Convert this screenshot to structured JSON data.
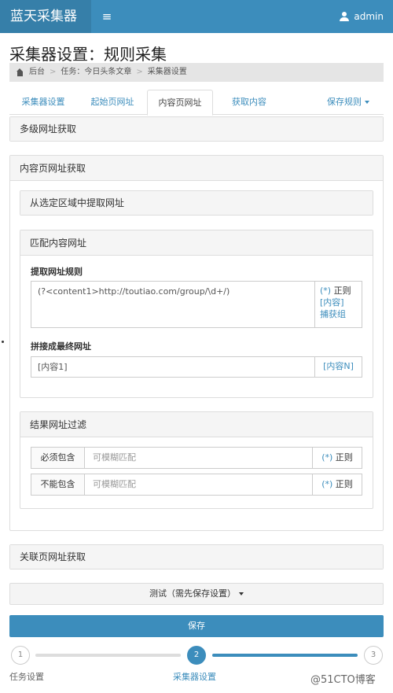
{
  "header": {
    "brand": "蓝天采集器",
    "menu_icon": "≡",
    "user": "admin"
  },
  "page": {
    "title": "采集器设置：规则采集"
  },
  "breadcrumb": {
    "home": "后台",
    "task": "任务：今日头条文章",
    "current": "采集器设置"
  },
  "tabs": [
    {
      "label": "采集器设置"
    },
    {
      "label": "起始页网址"
    },
    {
      "label": "内容页网址"
    },
    {
      "label": "获取内容"
    }
  ],
  "save_rules": {
    "label": "保存规则"
  },
  "sections": {
    "multi_level": "多级网址获取",
    "content_url": "内容页网址获取",
    "extract_region": "从选定区域中提取网址",
    "match_content": "匹配内容网址",
    "result_filter": "结果网址过滤",
    "related_url": "关联页网址获取"
  },
  "match": {
    "rule_label": "提取网址规则",
    "rule_value": "(?<content1>http://toutiao.com/group/\\d+/)",
    "rule_addon_regex": "(*)",
    "rule_addon_regex_label": "正则",
    "rule_addon_content": "[内容]",
    "rule_addon_capture": "捕获组",
    "final_label": "拼接成最终网址",
    "final_value": "[内容1]",
    "final_addon": "[内容N]"
  },
  "filters": [
    {
      "label": "必须包含",
      "placeholder": "可模糊匹配",
      "addon_symbol": "(*)",
      "addon_text": "正则"
    },
    {
      "label": "不能包含",
      "placeholder": "可模糊匹配",
      "addon_symbol": "(*)",
      "addon_text": "正则"
    }
  ],
  "buttons": {
    "test": "测试（需先保存设置）",
    "save": "保存"
  },
  "steps": [
    {
      "number": "1",
      "label": "任务设置"
    },
    {
      "number": "2",
      "label": "采集器设置"
    },
    {
      "number": "3",
      "label": ""
    }
  ],
  "watermark": "@51CTO博客",
  "colors": {
    "primary": "#3c8dbc",
    "brand_bg": "#367fa9"
  }
}
